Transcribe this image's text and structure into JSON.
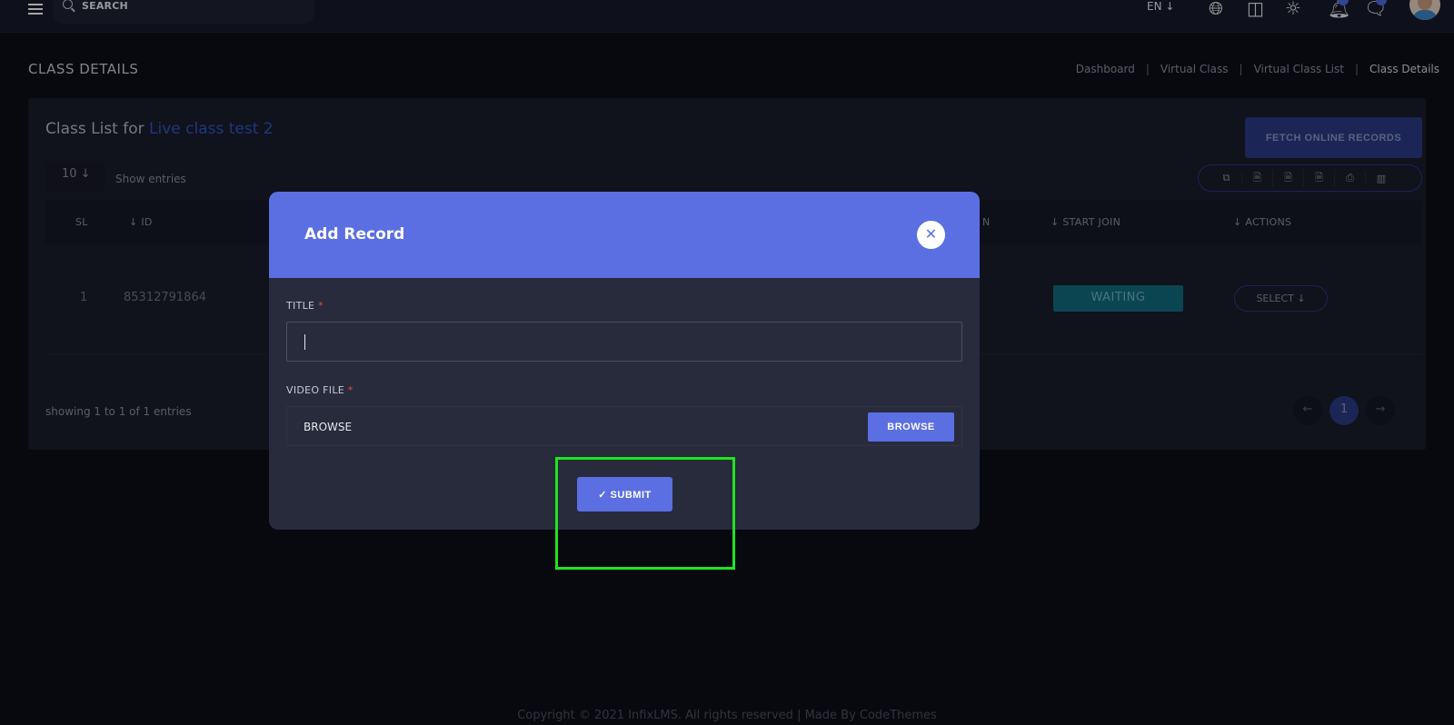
{
  "topbar": {
    "search_label": "SEARCH",
    "lang": "EN ↓",
    "icons": [
      "menu-icon",
      "search-icon",
      "globe-icon",
      "layout-icon",
      "sun-icon",
      "bell-icon",
      "chat-icon"
    ]
  },
  "page": {
    "title": "CLASS DETAILS",
    "breadcrumb": [
      "Dashboard",
      "Virtual Class",
      "Virtual Class List",
      "Class Details"
    ]
  },
  "card": {
    "title_prefix": "Class List for ",
    "title_link": "Live class test 2",
    "fetch_button": "FETCH ONLINE RECORDS",
    "entries_value": "10 ↓",
    "entries_label": "Show entries",
    "export_icons": [
      "⧉",
      "🗎",
      "🗎",
      "🗎",
      "⎙",
      "▥"
    ],
    "columns": {
      "sl": "SL",
      "id": "↓  ID",
      "join": "N",
      "start_join": "↓  START JOIN",
      "actions": "↓  ACTIONS"
    },
    "rows": [
      {
        "sl": "1",
        "id": "85312791864",
        "status": "WAITING",
        "action": "SELECT  ↓"
      }
    ],
    "showing": "showing 1 to 1 of 1 entries",
    "pager": {
      "prev": "←",
      "current": "1",
      "next": "→"
    }
  },
  "footer": "Copyright © 2021 InfixLMS. All rights reserved | Made By CodeThemes",
  "modal": {
    "title": "Add Record",
    "close": "✕",
    "title_label": "TITLE",
    "required_mark": "*",
    "title_value": "",
    "video_label": "VIDEO FILE",
    "file_text": "BROWSE",
    "browse_button": "BROWSE",
    "submit_button": "✓  SUBMIT"
  },
  "colors": {
    "accent": "#5b6fe3",
    "highlight": "#1fe41f",
    "waiting": "#136b7e"
  }
}
